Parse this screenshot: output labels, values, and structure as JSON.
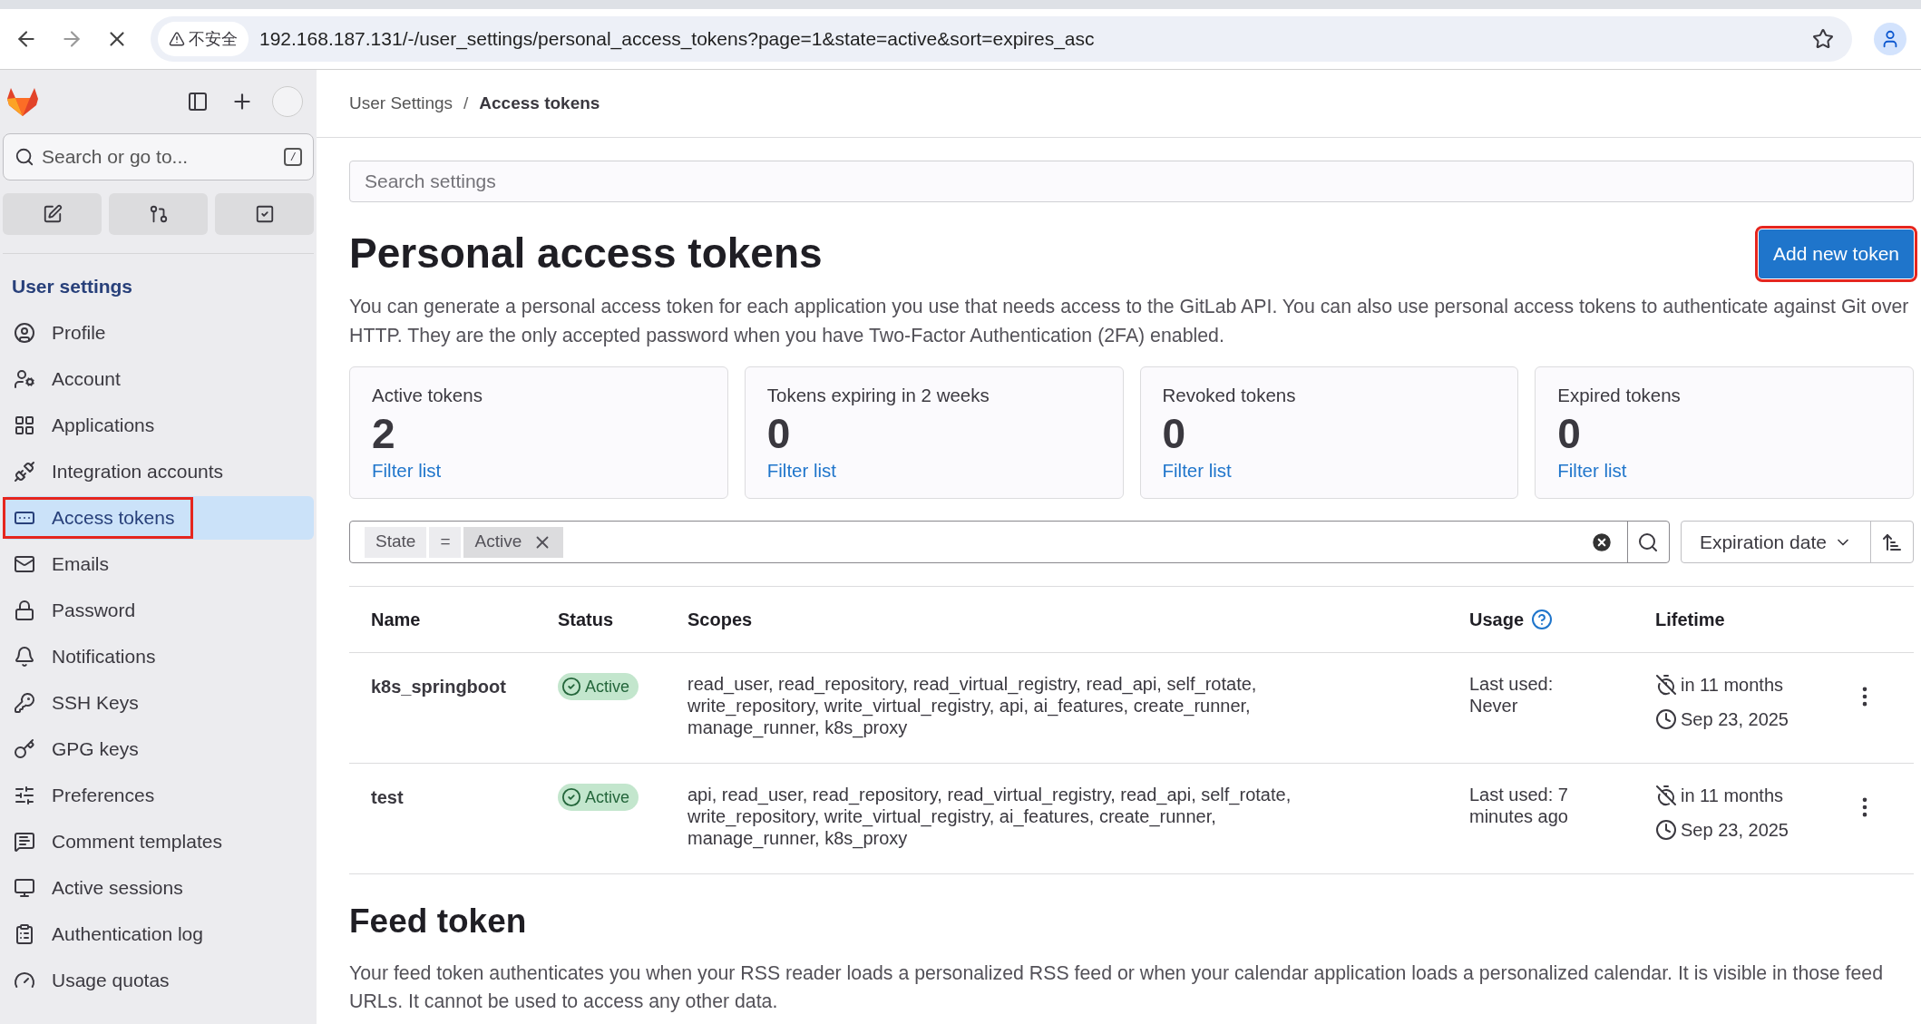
{
  "browser": {
    "security_label": "不安全",
    "url": "192.168.187.131/-/user_settings/personal_access_tokens?page=1&state=active&sort=expires_asc"
  },
  "sidebar": {
    "search_placeholder": "Search or go to...",
    "shortcut_key": "/",
    "section_title": "User settings",
    "items": [
      {
        "label": "Profile",
        "selected": false,
        "annotated": false
      },
      {
        "label": "Account",
        "selected": false,
        "annotated": false
      },
      {
        "label": "Applications",
        "selected": false,
        "annotated": false
      },
      {
        "label": "Integration accounts",
        "selected": false,
        "annotated": false
      },
      {
        "label": "Access tokens",
        "selected": true,
        "annotated": true
      },
      {
        "label": "Emails",
        "selected": false,
        "annotated": false
      },
      {
        "label": "Password",
        "selected": false,
        "annotated": false
      },
      {
        "label": "Notifications",
        "selected": false,
        "annotated": false
      },
      {
        "label": "SSH Keys",
        "selected": false,
        "annotated": false
      },
      {
        "label": "GPG keys",
        "selected": false,
        "annotated": false
      },
      {
        "label": "Preferences",
        "selected": false,
        "annotated": false
      },
      {
        "label": "Comment templates",
        "selected": false,
        "annotated": false
      },
      {
        "label": "Active sessions",
        "selected": false,
        "annotated": false
      },
      {
        "label": "Authentication log",
        "selected": false,
        "annotated": false
      },
      {
        "label": "Usage quotas",
        "selected": false,
        "annotated": false
      }
    ]
  },
  "breadcrumb": [
    "User Settings",
    "Access tokens"
  ],
  "breadcrumb_separator": "/",
  "search_settings": {
    "placeholder": "Search settings"
  },
  "title": "Personal access tokens",
  "add_button": {
    "label": "Add new token",
    "annotated": true
  },
  "description": "You can generate a personal access token for each application you use that needs access to the GitLab API. You can also use personal access tokens to authenticate against Git over HTTP. They are the only accepted password when you have Two-Factor Authentication (2FA) enabled.",
  "stats": [
    {
      "label": "Active tokens",
      "value": "2",
      "link": "Filter list"
    },
    {
      "label": "Tokens expiring in 2 weeks",
      "value": "0",
      "link": "Filter list"
    },
    {
      "label": "Revoked tokens",
      "value": "0",
      "link": "Filter list"
    },
    {
      "label": "Expired tokens",
      "value": "0",
      "link": "Filter list"
    }
  ],
  "filter": {
    "tokens": [
      "State",
      "=",
      "Active"
    ],
    "sort": "Expiration date"
  },
  "table": {
    "columns": [
      "Name",
      "Status",
      "Scopes",
      "Usage",
      "Lifetime"
    ],
    "rows": [
      {
        "name": "k8s_springboot",
        "status": {
          "kind": "active",
          "label": "Active"
        },
        "scopes": "read_user, read_repository, read_virtual_registry, read_api, self_rotate, write_repository, write_virtual_registry, api, ai_features, create_runner, manage_runner, k8s_proxy",
        "usage": "Last used: Never",
        "expires_in": "in 11 months",
        "expires_on": "Sep 23, 2025"
      },
      {
        "name": "test",
        "status": {
          "kind": "active",
          "label": "Active"
        },
        "scopes": "api, read_user, read_repository, read_virtual_registry, read_api, self_rotate, write_repository, write_virtual_registry, ai_features, create_runner, manage_runner, k8s_proxy",
        "usage": "Last used: 7 minutes ago",
        "expires_in": "in 11 months",
        "expires_on": "Sep 23, 2025"
      }
    ]
  },
  "feed": {
    "title": "Feed token",
    "description": "Your feed token authenticates you when your RSS reader loads a personalized RSS feed or when your calendar application loads a personalized calendar. It is visible in those feed URLs. It cannot be used to access any other data."
  }
}
